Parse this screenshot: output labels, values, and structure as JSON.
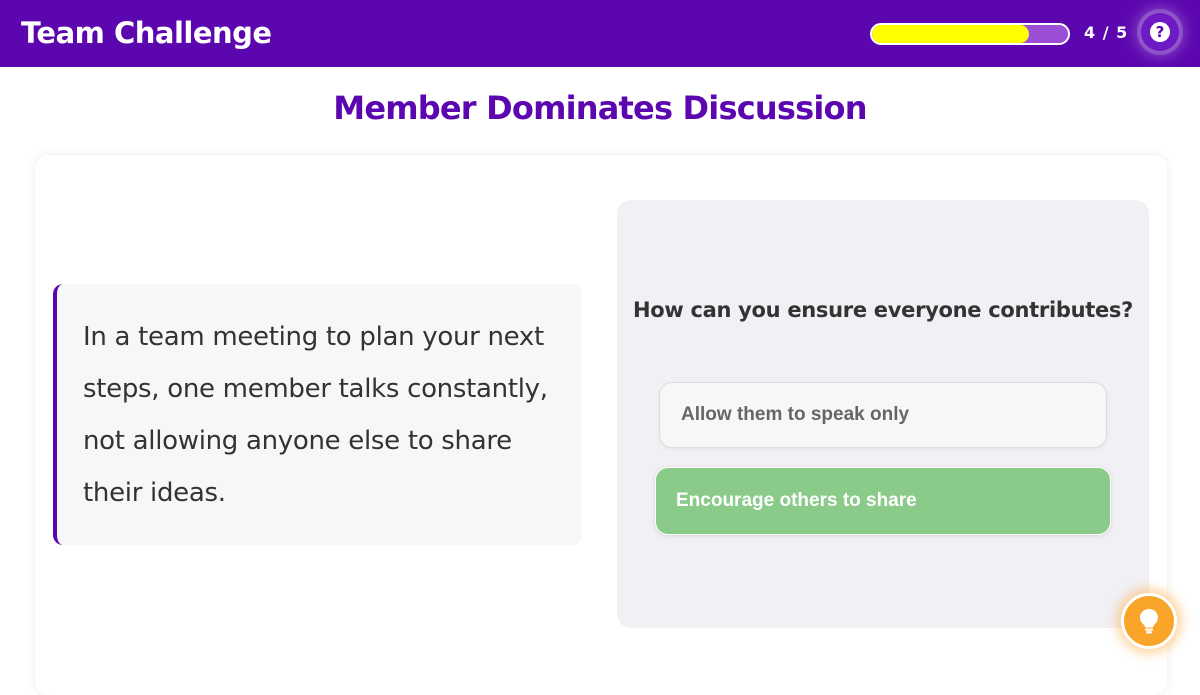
{
  "header": {
    "app_title": "Team Challenge",
    "progress": {
      "current": 4,
      "total": 5,
      "label": "4 / 5",
      "fill_fraction": 0.8
    },
    "help_icon": "question-circle-icon",
    "help_glyph": "?"
  },
  "scene": {
    "title": "Member Dominates Discussion",
    "scenario_text": "In a team meeting to plan your next steps, one member talks constantly, not allowing anyone else to share their ideas."
  },
  "question": {
    "prompt": "How can you ensure everyone contributes?",
    "options": [
      {
        "label": "Allow them to speak only",
        "state": "default"
      },
      {
        "label": "Encourage others to share",
        "state": "selected-correct"
      }
    ]
  },
  "hint": {
    "icon": "lightbulb-icon"
  },
  "colors": {
    "brand_purple": "#5c06b0",
    "progress_fill": "#ffff00",
    "correct_green": "#8acb8a",
    "hint_orange": "#f8a52a"
  }
}
